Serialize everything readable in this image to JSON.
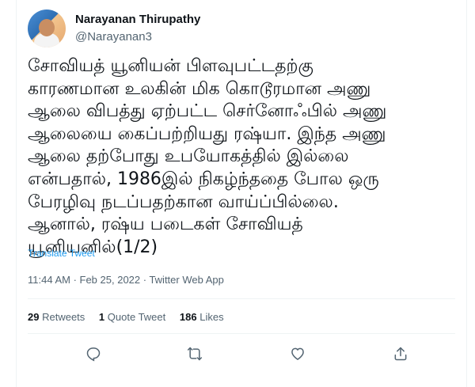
{
  "author": {
    "name": "Narayanan Thirupathy",
    "handle": "@Narayanan3"
  },
  "tweet": {
    "lines": [
      "சோவியத் யூனியன் பிளவுபட்டதற்கு",
      "காரணமான உலகின் மிக கொடூரமான அணு",
      "ஆலை விபத்து ஏற்பட்ட  செர்னோஃபில் அணு",
      "ஆலையை கைப்பற்றியது ரஷ்யா. இந்த அணு",
      "ஆலை தற்போது உபயோகத்தில் இல்லை",
      "என்பதால், 1986இல் நிகழ்ந்ததை போல ஒரு",
      "பேரழிவு நடப்பதற்கான வாய்ப்பில்லை.",
      "ஆனால், ரஷ்ய படைகள் சோவியத்",
      "யூனியனில்(1/2)"
    ],
    "translate_label": "Translate Tweet",
    "timestamp": "11:44 AM · Feb 25, 2022 · Twitter Web App"
  },
  "stats": {
    "retweets_count": "29",
    "retweets_label": "Retweets",
    "quotes_count": "1",
    "quotes_label": "Quote Tweet",
    "likes_count": "186",
    "likes_label": "Likes"
  },
  "icons": {
    "reply": "reply-icon",
    "retweet": "retweet-icon",
    "like": "heart-icon",
    "share": "share-icon"
  },
  "colors": {
    "link": "#1d9bf0",
    "muted": "#536471",
    "text": "#0f1419"
  }
}
